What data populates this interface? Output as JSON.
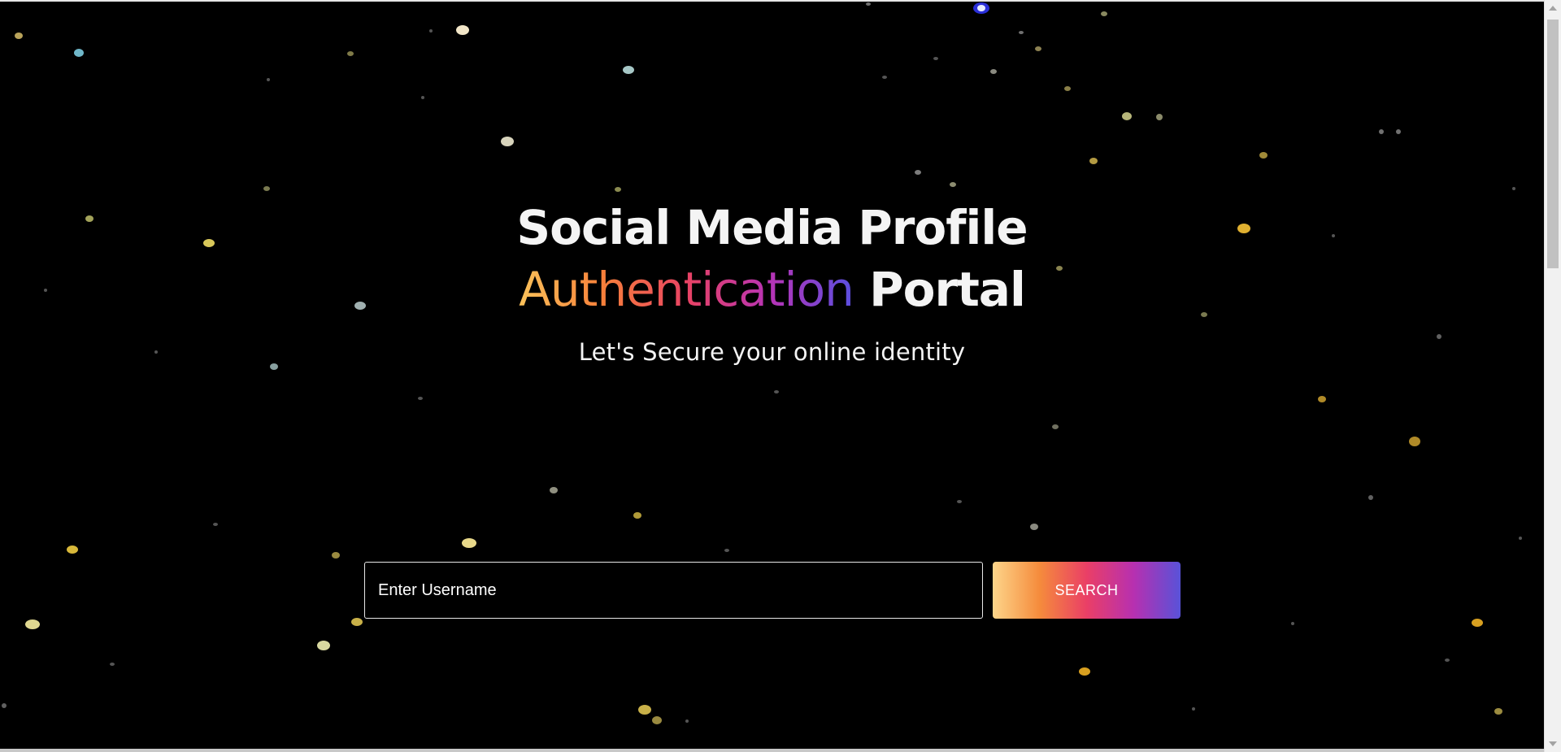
{
  "hero": {
    "title_line1": "Social Media Profile",
    "title_highlight": "Authentication",
    "title_rest": "Portal",
    "subtitle": "Let's Secure your online identity"
  },
  "search": {
    "placeholder": "Enter Username",
    "value": "",
    "button_label": "SEARCH"
  },
  "colors": {
    "background": "#000000",
    "gradient": [
      "#fbc25a",
      "#f7803a",
      "#e94363",
      "#b733b5",
      "#5a4fe0"
    ]
  }
}
